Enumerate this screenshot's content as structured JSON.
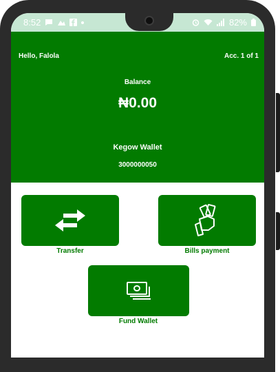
{
  "status_bar": {
    "time": "8:52",
    "battery": "82%"
  },
  "header": {
    "greeting": "Hello, Falola",
    "account_indicator": "Acc. 1 of 1",
    "balance_label": "Balance",
    "balance_amount": "₦0.00",
    "wallet_name": "Kegow Wallet",
    "wallet_number": "3000000050"
  },
  "actions": [
    {
      "label": "Transfer",
      "icon": "transfer-arrows-icon"
    },
    {
      "label": "Bills payment",
      "icon": "hand-holding-cash-icon"
    },
    {
      "label": "Fund Wallet",
      "icon": "cash-stack-icon"
    }
  ],
  "colors": {
    "primary": "#027b00",
    "status_bar": "#c6e7d3",
    "frame": "#2b2b2b"
  }
}
